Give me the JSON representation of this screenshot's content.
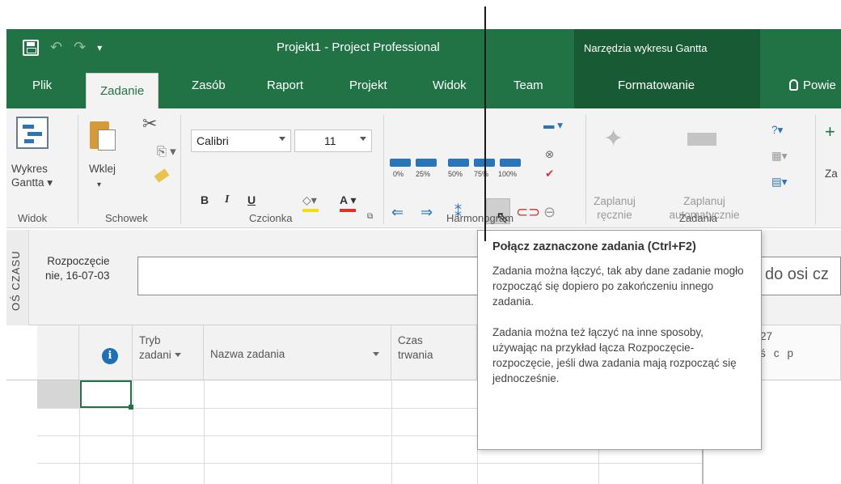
{
  "titlebar": {
    "title": "Projekt1 - Project Professional",
    "context_group": "Narzędzia wykresu Gantta"
  },
  "tabs": {
    "file": "Plik",
    "task": "Zadanie",
    "resource": "Zasób",
    "report": "Raport",
    "project": "Projekt",
    "view": "Widok",
    "team": "Team",
    "format": "Formatowanie",
    "tell_me": "Powie"
  },
  "ribbon": {
    "view_group": {
      "button": "Wykres",
      "button2": "Gantta",
      "label": "Widok"
    },
    "clipboard_group": {
      "paste": "Wklej",
      "label": "Schowek"
    },
    "font_group": {
      "font_name": "Calibri",
      "font_size": "11",
      "bold": "B",
      "italic": "I",
      "underline": "U",
      "font_color": "A",
      "label": "Czcionka"
    },
    "schedule_group": {
      "pct": [
        "0%",
        "25%",
        "50%",
        "75%",
        "100%"
      ],
      "label": "Harmonogram"
    },
    "tasks_group": {
      "manual_line1": "Zaplanuj",
      "manual_line2": "ręcznie",
      "auto_line1": "Zaplanuj",
      "auto_line2": "automatycznie",
      "label": "Zadania",
      "cut_label": "Za"
    }
  },
  "timeline": {
    "side_label": "OŚ CZASU",
    "start_line1": "Rozpoczęcie",
    "start_line2": "nie, 16-07-03",
    "hint": "do osi cz"
  },
  "grid": {
    "info_icon": "i",
    "col_mode_line1": "Tryb",
    "col_mode_line2": "zadani",
    "col_name": "Nazwa zadania",
    "col_duration_line1": "Czas",
    "col_duration_line2": "trwania",
    "gantt_header_top": "27",
    "gantt_days": [
      "ś",
      "c",
      "p"
    ]
  },
  "tooltip": {
    "title": "Połącz zaznaczone zadania (Ctrl+F2)",
    "para1": "Zadania można łączyć, tak aby dane zadanie mogło rozpocząć się dopiero po zakończeniu innego zadania.",
    "para2": "Zadania można też łączyć na inne sposoby, używając na przykład łącza Rozpoczęcie-rozpoczęcie, jeśli dwa zadania mają rozpocząć się jednocześnie."
  },
  "colors": {
    "brand_green": "#217346",
    "context_green": "#185a33",
    "accent_blue": "#2a74b8"
  }
}
